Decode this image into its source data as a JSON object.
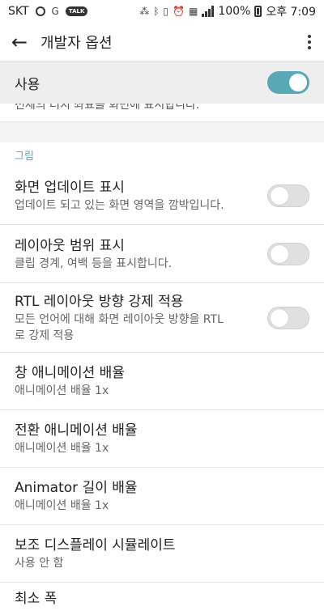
{
  "status": {
    "carrier": "SKT",
    "talk": "TALK",
    "battery": "100%",
    "time": "오후 7:09"
  },
  "appbar": {
    "title": "개발자 옵션"
  },
  "master": {
    "label": "사용",
    "state": "on"
  },
  "cutoff_text": "전체의 터치 좌표를 화면에 표시합니다.",
  "section_header": "그림",
  "items": [
    {
      "title": "화면 업데이트 표시",
      "sub": "업데이트 되고 있는 화면 영역을 깜박입니다.",
      "toggle": "off"
    },
    {
      "title": "레이아웃 범위 표시",
      "sub": "클립 경계, 여백 등을 표시합니다.",
      "toggle": "off"
    },
    {
      "title": "RTL 레이아웃 방향 강제 적용",
      "sub": "모든 언어에 대해 화면 레이아웃 방향을 RTL로 강제 적용",
      "toggle": "off"
    },
    {
      "title": "창 애니메이션 배율",
      "sub": "애니메이션 배율 1x"
    },
    {
      "title": "전환 애니메이션 배율",
      "sub": "애니메이션 배율 1x"
    },
    {
      "title": "Animator 길이 배율",
      "sub": "애니메이션 배율 1x"
    },
    {
      "title": "보조 디스플레이 시뮬레이트",
      "sub": "사용 안 함"
    },
    {
      "title": "최소 폭",
      "sub": ""
    }
  ],
  "colors": {
    "accent": "#5aa8b5",
    "toggle_off": "#e0e0e0"
  }
}
